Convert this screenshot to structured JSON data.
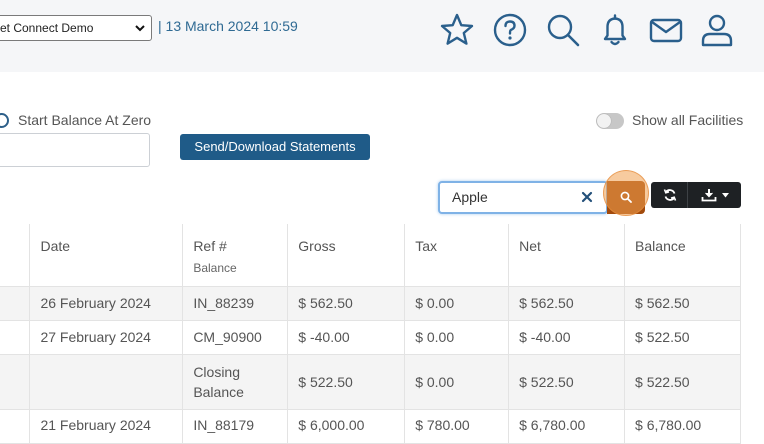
{
  "header": {
    "company_select": "et Connect Demo",
    "datetime": "| 13 March 2024 10:59",
    "icons": [
      "star-icon",
      "help-icon",
      "search-icon",
      "bell-icon",
      "mail-icon",
      "user-icon"
    ]
  },
  "options": {
    "start_balance_label": "Start Balance At Zero",
    "send_button": "Send/Download Statements",
    "show_all_label": "Show all Facilities"
  },
  "search": {
    "value": "Apple"
  },
  "table": {
    "columns": [
      "Date",
      "Ref #",
      "Gross",
      "Tax",
      "Net",
      "Balance"
    ],
    "header_overflow": "Balance",
    "rows": [
      {
        "date": "26 February 2024",
        "ref": "IN_88239",
        "gross": "$ 562.50",
        "tax": "$ 0.00",
        "net": "$ 562.50",
        "balance": "$ 562.50"
      },
      {
        "date": "27 February 2024",
        "ref": "CM_90900",
        "gross": "$ -40.00",
        "tax": "$ 0.00",
        "net": "$ -40.00",
        "balance": "$ 522.50"
      },
      {
        "date": "",
        "ref": "Closing Balance",
        "gross": "$ 522.50",
        "tax": "$ 0.00",
        "net": "$ 522.50",
        "balance": "$ 522.50"
      },
      {
        "date": "21 February 2024",
        "ref": "IN_88179",
        "gross": "$ 6,000.00",
        "tax": "$ 780.00",
        "net": "$ 6,780.00",
        "balance": "$ 6,780.00"
      }
    ]
  },
  "colors": {
    "primary": "#1f5b88",
    "search_button": "#a24a0c",
    "link_text": "#2f6a93"
  }
}
